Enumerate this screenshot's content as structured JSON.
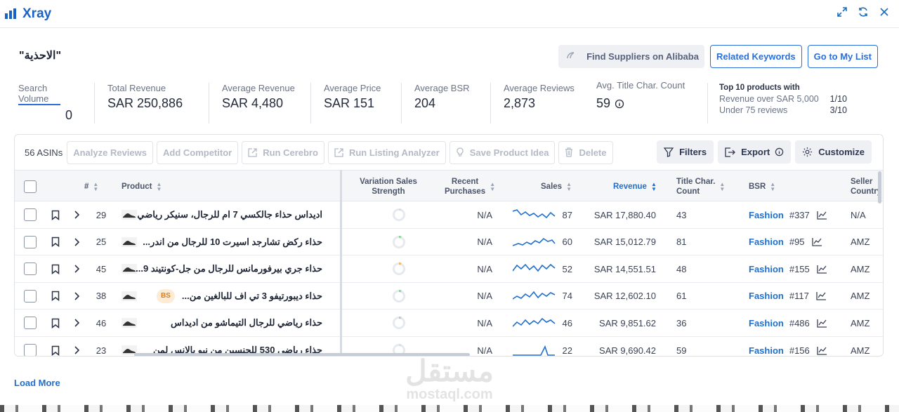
{
  "app": {
    "title": "Xray"
  },
  "keyword": "\"الاحذية\"",
  "header_buttons": {
    "alibaba": "Find Suppliers on Alibaba",
    "related": "Related Keywords",
    "mylist": "Go to My List"
  },
  "stats": {
    "search_volume": {
      "label": "Search Volume",
      "value": "0"
    },
    "total_revenue": {
      "label": "Total Revenue",
      "value": "SAR 250,886"
    },
    "avg_revenue": {
      "label": "Average Revenue",
      "value": "SAR 4,480"
    },
    "avg_price": {
      "label": "Average Price",
      "value": "SAR 151"
    },
    "avg_bsr": {
      "label": "Average BSR",
      "value": "204"
    },
    "avg_reviews": {
      "label": "Average Reviews",
      "value": "2,873"
    },
    "title_char": {
      "label": "Avg. Title Char. Count",
      "value": "59"
    },
    "top10": {
      "label": "Top 10 products with",
      "line1": "Revenue over SAR 5,000",
      "line1_val": "1/10",
      "line2": "Under 75 reviews",
      "line2_val": "3/10"
    }
  },
  "toolbar": {
    "asins": "56 ASINs",
    "analyze": "Analyze Reviews",
    "competitor": "Add Competitor",
    "cerebro": "Run Cerebro",
    "listing": "Run Listing Analyzer",
    "idea": "Save Product Idea",
    "delete": "Delete",
    "filters": "Filters",
    "export": "Export",
    "customize": "Customize"
  },
  "columns": {
    "num": "#",
    "product": "Product",
    "vss1": "Variation Sales",
    "vss2": "Strength",
    "recent1": "Recent",
    "recent2": "Purchases",
    "sales": "Sales",
    "revenue": "Revenue",
    "tcc1": "Title Char.",
    "tcc2": "Count",
    "bsr": "BSR",
    "country1": "Seller",
    "country2": "Country"
  },
  "rows": [
    {
      "num": "29",
      "title": "اديداس حذاء جالكسي 7 ام للرجال، سنيكر رياضي",
      "bs": "",
      "recent": "N/A",
      "sales": "87",
      "revenue": "SAR 17,880.40",
      "tcc": "43",
      "category": "Fashion",
      "bsr": "#337",
      "country": "N/A",
      "ring": "#d9dde3"
    },
    {
      "num": "25",
      "title": "حذاء ركض تشارجد اسيرت 10 للرجال من اندر...",
      "bs": "",
      "recent": "N/A",
      "sales": "60",
      "revenue": "SAR 15,012.79",
      "tcc": "81",
      "category": "Fashion",
      "bsr": "#95",
      "country": "AMZ",
      "ring": "#8bd49a"
    },
    {
      "num": "45",
      "title": "حذاء جري بيرفورمانس للرجال من جل-كونتيند 9...",
      "bs": "",
      "recent": "N/A",
      "sales": "52",
      "revenue": "SAR 14,551.51",
      "tcc": "48",
      "category": "Fashion",
      "bsr": "#155",
      "country": "AMZ",
      "ring": "#f3b56b"
    },
    {
      "num": "38",
      "title": "حذاء ديبورتيفو 3 تي اف للبالغين من...",
      "bs": "BS",
      "recent": "N/A",
      "sales": "74",
      "revenue": "SAR 12,602.10",
      "tcc": "61",
      "category": "Fashion",
      "bsr": "#117",
      "country": "AMZ",
      "ring": "#8bd49a"
    },
    {
      "num": "46",
      "title": "حذاء رياضي للرجال التيماشو من اديداس",
      "bs": "",
      "recent": "N/A",
      "sales": "46",
      "revenue": "SAR 9,851.62",
      "tcc": "36",
      "category": "Fashion",
      "bsr": "#486",
      "country": "AMZ",
      "ring": "#bfc4cc"
    },
    {
      "num": "23",
      "title": "حذاء رياضي 530 للجنسين من نيو بالانس لمن",
      "bs": "",
      "recent": "N/A",
      "sales": "22",
      "revenue": "SAR 9,690.42",
      "tcc": "59",
      "category": "Fashion",
      "bsr": "#156",
      "country": "AMZ",
      "ring": "#d9dde3"
    }
  ],
  "load_more": "Load More",
  "watermark": {
    "ar": "مستقل",
    "en": "mostaql.com"
  }
}
